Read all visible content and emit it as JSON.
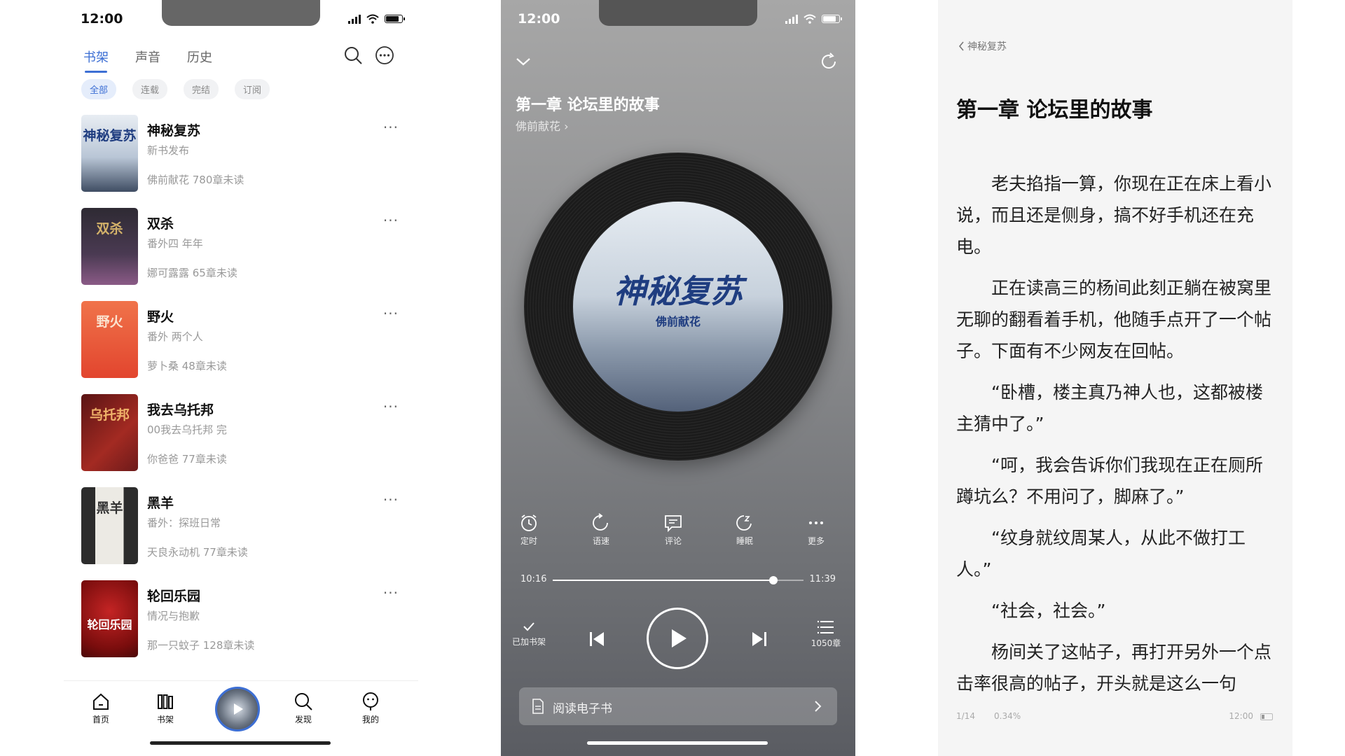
{
  "status": {
    "time": "12:00"
  },
  "shelf": {
    "tabs": [
      "书架",
      "声音",
      "历史"
    ],
    "filters": [
      "全部",
      "连载",
      "完结",
      "订阅"
    ],
    "books": [
      {
        "title": "神秘复苏",
        "subtitle": "新书发布",
        "meta": "佛前献花  780章未读",
        "cover_text": "神秘复苏",
        "cover_color": "#c9d3df"
      },
      {
        "title": "双杀",
        "subtitle": "番外四 年年",
        "meta": "娜可露露  65章未读",
        "cover_text": "双杀",
        "cover_color": "#3a3140"
      },
      {
        "title": "野火",
        "subtitle": "番外 两个人",
        "meta": "萝卜桑  48章未读",
        "cover_text": "野火",
        "cover_color": "#e3593b"
      },
      {
        "title": "我去乌托邦",
        "subtitle": "00我去乌托邦 完",
        "meta": "你爸爸  77章未读",
        "cover_text": "乌托邦",
        "cover_color": "#7d1f1f"
      },
      {
        "title": "黑羊",
        "subtitle": "番外：探班日常",
        "meta": "天良永动机  77章未读",
        "cover_text": "黑羊",
        "cover_color": "#3b3b3b"
      },
      {
        "title": "轮回乐园",
        "subtitle": "情况与抱歉",
        "meta": "那一只蚊子  128章未读",
        "cover_text": "轮回乐园",
        "cover_color": "#8f1414"
      }
    ],
    "tabbar": [
      "首页",
      "书架",
      "发现",
      "我的"
    ]
  },
  "player": {
    "chapter_title": "第一章 论坛里的故事",
    "author": "佛前献花",
    "disc_title": "神秘复苏",
    "disc_author": "佛前献花",
    "controls": [
      "定时",
      "语速",
      "评论",
      "睡眠",
      "更多"
    ],
    "time_current": "10:16",
    "time_total": "11:39",
    "progress": 0.88,
    "shelf_label": "已加书架",
    "chapters_label": "1050章",
    "ebook_label": "阅读电子书"
  },
  "reader": {
    "back_label": "神秘复苏",
    "title": "第一章 论坛里的故事",
    "paragraphs": [
      "老夫掐指一算，你现在正在床上看小说，而且还是侧身，搞不好手机还在充电。",
      "正在读高三的杨间此刻正躺在被窝里无聊的翻看着手机，他随手点开了一个帖子。下面有不少网友在回帖。",
      "“卧槽，楼主真乃神人也，这都被楼主猜中了。”",
      "“呵，我会告诉你们我现在正在厕所蹲坑么？不用问了，脚麻了。”",
      "“纹身就纹周某人，从此不做打工人。”",
      "“社会，社会。”",
      "杨间关了这帖子，再打开另外一个点击率很高的帖子，开头就是这么一句"
    ],
    "page": "1/14",
    "percent": "0.34%",
    "clock": "12:00"
  }
}
